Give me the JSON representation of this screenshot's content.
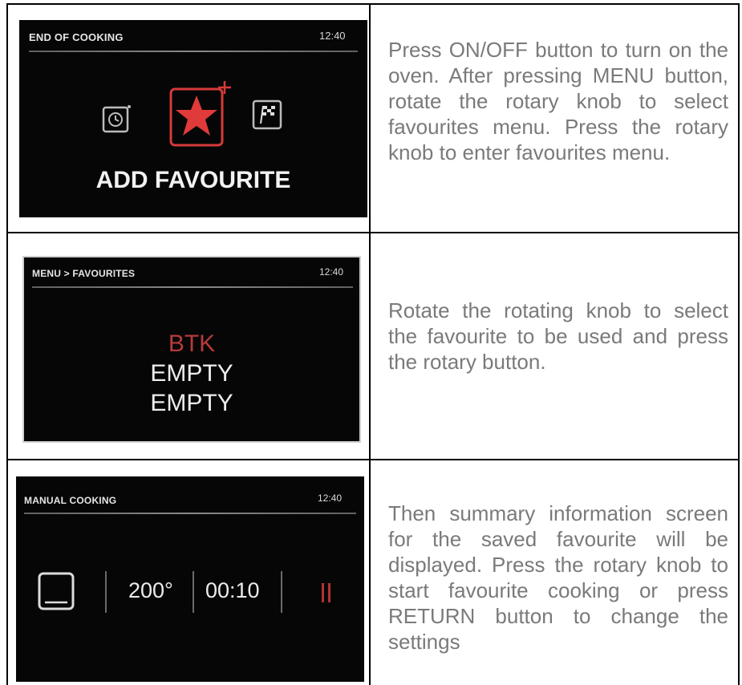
{
  "rows": [
    {
      "screen": {
        "title": "END OF COOKING",
        "time": "12:40",
        "main_label": "ADD FAVOURITE",
        "icons": [
          "timer-icon",
          "favourite-star-icon",
          "finish-flag-icon"
        ]
      },
      "description": "Press ON/OFF button to turn on the oven. After pressing MENU button, rotate the rotary knob to select favourites menu. Press the rotary knob to enter favourites menu."
    },
    {
      "screen": {
        "title": "MENU > FAVOURITES",
        "time": "12:40",
        "items": [
          "BTK",
          "EMPTY",
          "EMPTY"
        ],
        "selected_color": "#b83a3a"
      },
      "description": "Rotate the rotating knob to select the favourite to be used and press the rotary button."
    },
    {
      "screen": {
        "title": "MANUAL COOKING",
        "time": "12:40",
        "temperature": "200°",
        "duration": "00:10",
        "icons": [
          "oven-mode-icon",
          "pause-icon"
        ]
      },
      "description": "Then summary information screen for the saved favourite will be displayed. Press the rotary knob to start favourite cooking or press RETURN button to change the settings"
    }
  ],
  "colors": {
    "accent_red": "#d63a3a",
    "text_grey": "#7a7a7a",
    "screen_bg": "#060606"
  }
}
